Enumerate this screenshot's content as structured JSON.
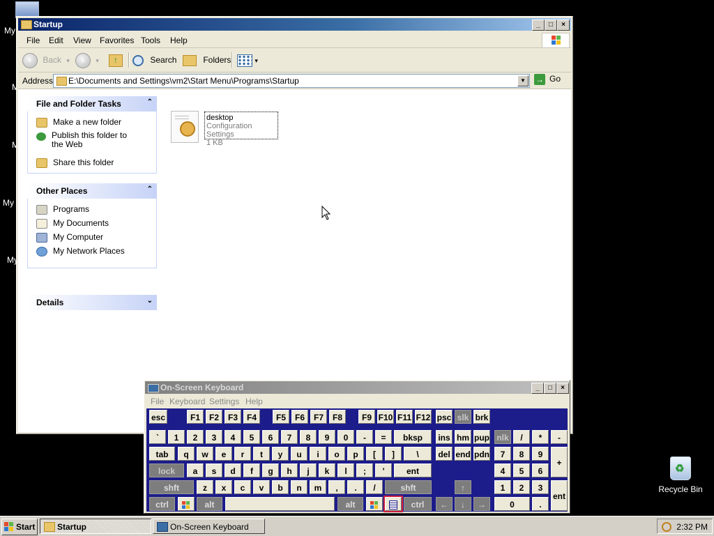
{
  "desktop": {
    "icon_labels": [
      "My",
      "M",
      "M",
      "My",
      "My"
    ],
    "recycle_bin": "Recycle Bin"
  },
  "explorer": {
    "title": "Startup",
    "menu": [
      "File",
      "Edit",
      "View",
      "Favorites",
      "Tools",
      "Help"
    ],
    "toolbar": {
      "back": "Back",
      "search": "Search",
      "folders": "Folders"
    },
    "address": {
      "label": "Address",
      "value": "E:\\Documents and Settings\\vm2\\Start Menu\\Programs\\Startup",
      "go": "Go"
    },
    "panels": {
      "file_folder_tasks": {
        "title": "File and Folder Tasks",
        "items": [
          "Make a new folder",
          "Publish this folder to the Web",
          "Share this folder"
        ]
      },
      "other_places": {
        "title": "Other Places",
        "items": [
          "Programs",
          "My Documents",
          "My Computer",
          "My Network Places"
        ]
      },
      "details": {
        "title": "Details"
      }
    },
    "file": {
      "name": "desktop",
      "type": "Configuration Settings",
      "size": "1 KB"
    }
  },
  "osk": {
    "title": "On-Screen Keyboard",
    "menu": [
      "File",
      "Keyboard",
      "Settings",
      "Help"
    ],
    "keys": {
      "row1": [
        "esc",
        "F1",
        "F2",
        "F3",
        "F4",
        "F5",
        "F6",
        "F7",
        "F8",
        "F9",
        "F10",
        "F11",
        "F12",
        "psc",
        "slk",
        "brk"
      ],
      "row2": [
        "`",
        "1",
        "2",
        "3",
        "4",
        "5",
        "6",
        "7",
        "8",
        "9",
        "0",
        "-",
        "=",
        "bksp",
        "ins",
        "hm",
        "pup",
        "nlk",
        "/",
        "*",
        "-"
      ],
      "row3": [
        "tab",
        "q",
        "w",
        "e",
        "r",
        "t",
        "y",
        "u",
        "i",
        "o",
        "p",
        "[",
        "]",
        "\\",
        "del",
        "end",
        "pdn",
        "7",
        "8",
        "9",
        "+"
      ],
      "row4": [
        "lock",
        "a",
        "s",
        "d",
        "f",
        "g",
        "h",
        "j",
        "k",
        "l",
        ";",
        "'",
        "ent",
        "4",
        "5",
        "6"
      ],
      "row5": [
        "shft",
        "z",
        "x",
        "c",
        "v",
        "b",
        "n",
        "m",
        ",",
        ".",
        "/",
        "shft",
        "↑",
        "1",
        "2",
        "3",
        "ent"
      ],
      "row6": [
        "ctrl",
        "alt",
        "alt",
        "ctrl",
        "←",
        "↓",
        "→",
        "0",
        "."
      ]
    }
  },
  "taskbar": {
    "start": "Start",
    "buttons": [
      "Startup",
      "On-Screen Keyboard"
    ],
    "clock": "2:32 PM"
  },
  "colors": {
    "titlebar_active": "#0a246a",
    "osk_background": "#1c1c8a",
    "panel_header": "#c6d3f7"
  }
}
